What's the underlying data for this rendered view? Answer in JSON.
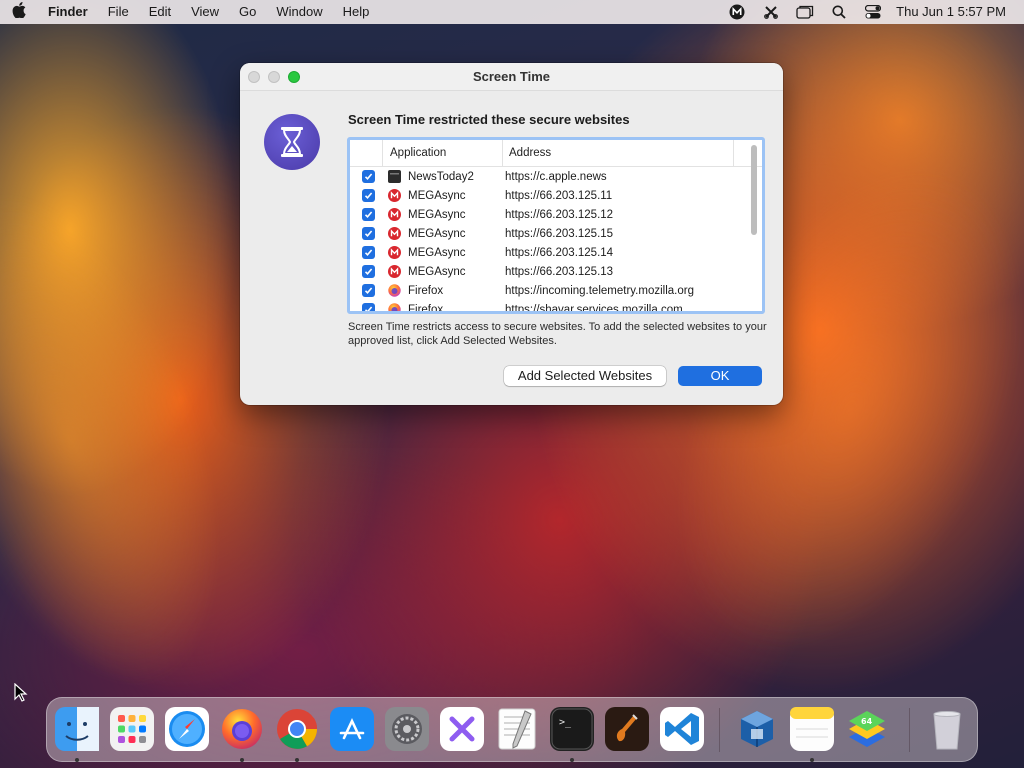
{
  "menubar": {
    "apple_icon": "apple-icon",
    "app_name": "Finder",
    "menus": [
      "File",
      "Edit",
      "View",
      "Go",
      "Window",
      "Help"
    ],
    "status_icons": [
      "megasync-icon",
      "scissors-icon",
      "windows-icon",
      "search-icon",
      "control-center-icon"
    ],
    "clock": "Thu Jun 1  5:57 PM"
  },
  "dialog": {
    "title": "Screen Time",
    "headline": "Screen Time restricted these secure websites",
    "columns": {
      "application": "Application",
      "address": "Address"
    },
    "rows": [
      {
        "checked": true,
        "app": "NewsToday2",
        "icon": "newstoday-icon",
        "address": "https://c.apple.news"
      },
      {
        "checked": true,
        "app": "MEGAsync",
        "icon": "megasync-icon",
        "address": "https://66.203.125.11"
      },
      {
        "checked": true,
        "app": "MEGAsync",
        "icon": "megasync-icon",
        "address": "https://66.203.125.12"
      },
      {
        "checked": true,
        "app": "MEGAsync",
        "icon": "megasync-icon",
        "address": "https://66.203.125.15"
      },
      {
        "checked": true,
        "app": "MEGAsync",
        "icon": "megasync-icon",
        "address": "https://66.203.125.14"
      },
      {
        "checked": true,
        "app": "MEGAsync",
        "icon": "megasync-icon",
        "address": "https://66.203.125.13"
      },
      {
        "checked": true,
        "app": "Firefox",
        "icon": "firefox-icon",
        "address": "https://incoming.telemetry.mozilla.org"
      },
      {
        "checked": true,
        "app": "Firefox",
        "icon": "firefox-icon",
        "address": "https://shavar.services.mozilla.com"
      }
    ],
    "description": "Screen Time restricts access to secure websites. To add the selected websites to your approved list, click Add Selected Websites.",
    "add_button": "Add Selected Websites",
    "ok_button": "OK"
  },
  "dock": {
    "apps": [
      {
        "name": "finder",
        "running": true
      },
      {
        "name": "launchpad",
        "running": false
      },
      {
        "name": "safari",
        "running": false
      },
      {
        "name": "firefox",
        "running": true
      },
      {
        "name": "chrome",
        "running": true
      },
      {
        "name": "app-store",
        "running": false
      },
      {
        "name": "system-settings",
        "running": false
      },
      {
        "name": "xcode-like-x",
        "running": false
      },
      {
        "name": "textedit",
        "running": false
      },
      {
        "name": "terminal",
        "running": true
      },
      {
        "name": "garageband",
        "running": false
      },
      {
        "name": "vscode",
        "running": false
      },
      {
        "name": "virtualbox",
        "running": false
      },
      {
        "name": "notes",
        "running": true
      },
      {
        "name": "bluestacks",
        "running": false
      },
      {
        "name": "trash",
        "running": false
      }
    ]
  },
  "colors": {
    "accent": "#1f6fe0",
    "zoom_button": "#2ac840",
    "mega_red": "#d9272e",
    "screen_time_purple": "#4a3aa8"
  }
}
